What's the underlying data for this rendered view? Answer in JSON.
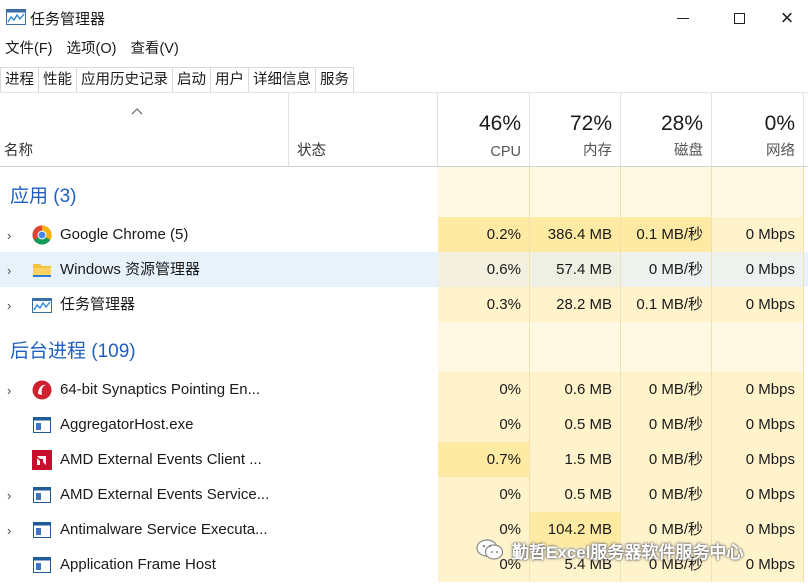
{
  "window": {
    "title": "任务管理器",
    "controls": {
      "minimize": "minimize-icon",
      "maximize": "maximize-icon",
      "close": "×"
    }
  },
  "menu": [
    "文件(F)",
    "选项(O)",
    "查看(V)"
  ],
  "tabs": [
    "进程",
    "性能",
    "应用历史记录",
    "启动",
    "用户",
    "详细信息",
    "服务"
  ],
  "active_tab": "进程",
  "header": {
    "name": "名称",
    "status": "状态",
    "cpu": {
      "pct": "46%",
      "label": "CPU"
    },
    "memory": {
      "pct": "72%",
      "label": "内存"
    },
    "disk": {
      "pct": "28%",
      "label": "磁盘"
    },
    "network": {
      "pct": "0%",
      "label": "网络"
    }
  },
  "groups": {
    "apps": {
      "title": "应用 (3)"
    },
    "background": {
      "title": "后台进程 (109)"
    }
  },
  "apps": [
    {
      "name": "Google Chrome (5)",
      "icon": "chrome-icon",
      "cpu": "0.2%",
      "mem": "386.4 MB",
      "disk": "0.1 MB/秒",
      "net": "0 Mbps"
    },
    {
      "name": "Windows 资源管理器",
      "icon": "folder-icon",
      "cpu": "0.6%",
      "mem": "57.4 MB",
      "disk": "0 MB/秒",
      "net": "0 Mbps"
    },
    {
      "name": "任务管理器",
      "icon": "task-manager-icon",
      "cpu": "0.3%",
      "mem": "28.2 MB",
      "disk": "0.1 MB/秒",
      "net": "0 Mbps"
    }
  ],
  "background": [
    {
      "name": "64-bit Synaptics Pointing En...",
      "icon": "synaptics-icon",
      "cpu": "0%",
      "mem": "0.6 MB",
      "disk": "0 MB/秒",
      "net": "0 Mbps"
    },
    {
      "name": "AggregatorHost.exe",
      "icon": "window-icon",
      "cpu": "0%",
      "mem": "0.5 MB",
      "disk": "0 MB/秒",
      "net": "0 Mbps"
    },
    {
      "name": "AMD External Events Client ...",
      "icon": "amd-icon",
      "cpu": "0.7%",
      "mem": "1.5 MB",
      "disk": "0 MB/秒",
      "net": "0 Mbps"
    },
    {
      "name": "AMD External Events Service...",
      "icon": "window-icon",
      "cpu": "0%",
      "mem": "0.5 MB",
      "disk": "0 MB/秒",
      "net": "0 Mbps"
    },
    {
      "name": "Antimalware Service Executa...",
      "icon": "window-icon",
      "cpu": "0%",
      "mem": "104.2 MB",
      "disk": "0 MB/秒",
      "net": "0 Mbps"
    },
    {
      "name": "Application Frame Host",
      "icon": "window-icon",
      "cpu": "0%",
      "mem": "5.4 MB",
      "disk": "0 MB/秒",
      "net": "0 Mbps"
    }
  ],
  "watermark": {
    "text": "勤哲Excel服务器软件服务中心"
  },
  "colors": {
    "group_title": "#1f5fbf",
    "heat_light": "#fff9e3",
    "heat_mid": "#fff3cc",
    "heat_strong": "#ffeaa3",
    "selected_row": "#e8f2fb"
  }
}
